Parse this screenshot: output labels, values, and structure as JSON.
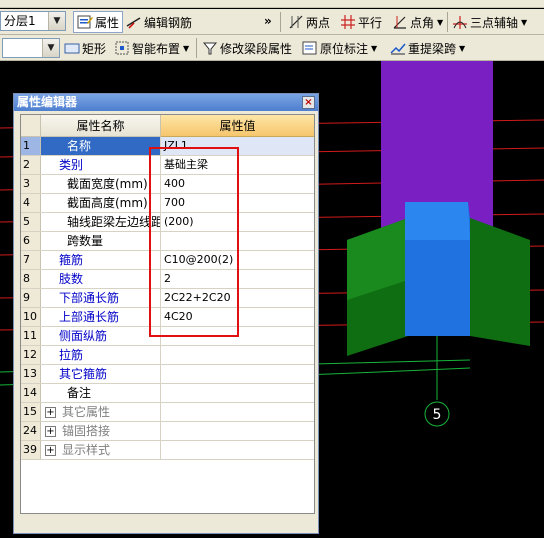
{
  "toolbar_row1": {
    "layer_combo_value": "分层1",
    "property_button": "属性",
    "edit_rebar_button": "编辑钢筋",
    "overflow_glyph": "»",
    "two_points": "两点",
    "parallel": "平行",
    "point_angle": "点角",
    "three_point_aux": "三点辅轴"
  },
  "toolbar_row2": {
    "combo_value": "",
    "rectangle": "矩形",
    "smart_layout": "智能布置",
    "modify_segment_props": "修改梁段属性",
    "in_place_annotation": "原位标注",
    "re_extract_span": "重提梁跨"
  },
  "panel": {
    "title": "属性编辑器",
    "close_glyph": "×",
    "col_name": "属性名称",
    "col_value": "属性值",
    "rows": [
      {
        "num": "1",
        "name": "名称",
        "value": "JZL1"
      },
      {
        "num": "2",
        "name": "类别",
        "value": "基础主梁"
      },
      {
        "num": "3",
        "name": "截面宽度(mm)",
        "value": "400"
      },
      {
        "num": "4",
        "name": "截面高度(mm)",
        "value": "700"
      },
      {
        "num": "5",
        "name": "轴线距梁左边线距",
        "value": "(200)"
      },
      {
        "num": "6",
        "name": "跨数量",
        "value": ""
      },
      {
        "num": "7",
        "name": "箍筋",
        "value": "C10@200(2)"
      },
      {
        "num": "8",
        "name": "肢数",
        "value": "2"
      },
      {
        "num": "9",
        "name": "下部通长筋",
        "value": "2C22+2C20"
      },
      {
        "num": "10",
        "name": "上部通长筋",
        "value": "4C20"
      },
      {
        "num": "11",
        "name": "侧面纵筋",
        "value": ""
      },
      {
        "num": "12",
        "name": "拉筋",
        "value": ""
      },
      {
        "num": "13",
        "name": "其它箍筋",
        "value": ""
      },
      {
        "num": "14",
        "name": "备注",
        "value": ""
      },
      {
        "num": "15",
        "name": "其它属性",
        "value": ""
      },
      {
        "num": "24",
        "name": "锚固搭接",
        "value": ""
      },
      {
        "num": "39",
        "name": "显示样式",
        "value": ""
      }
    ]
  },
  "canvas": {
    "axis_label": "5"
  },
  "colors": {
    "column": "#7a1fc2",
    "beam_side": "#0f6e12",
    "beam_top": "#2b7de8",
    "grid_line": "#d11a1a",
    "highlight_box": "#e01010"
  }
}
